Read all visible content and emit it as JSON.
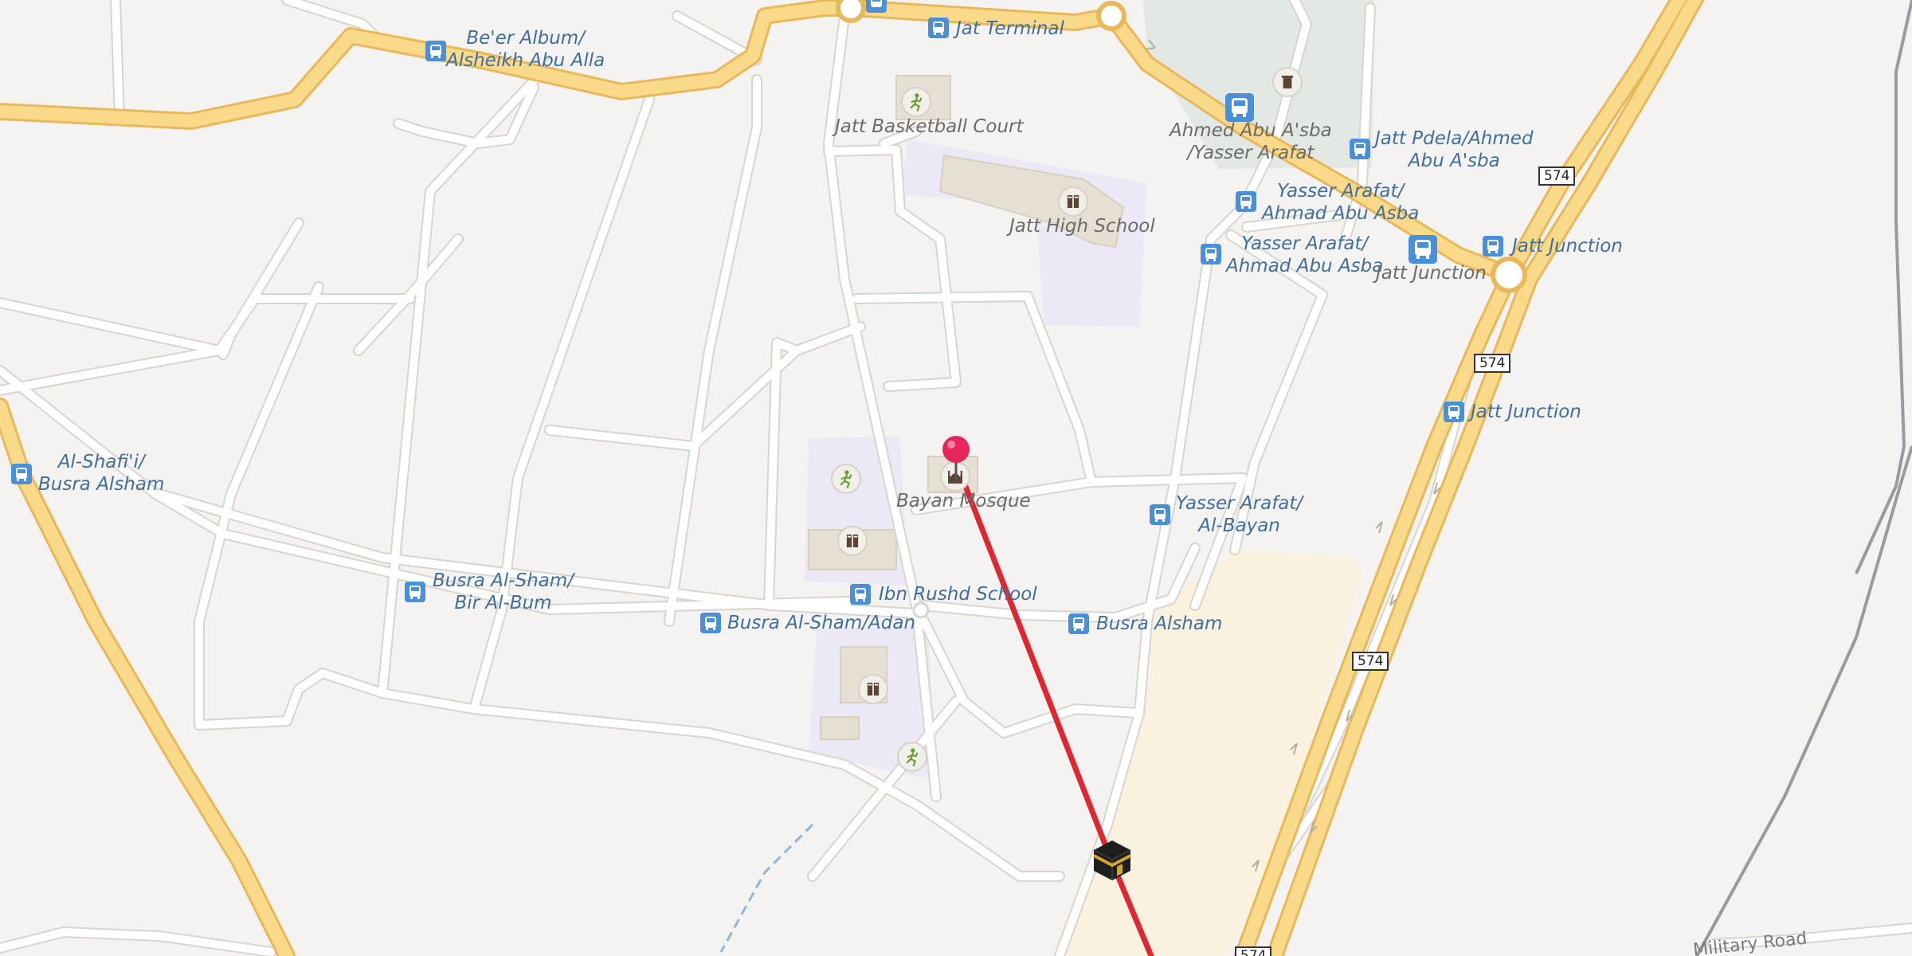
{
  "map": {
    "colors": {
      "background": "#f5f3f1",
      "minor_road": "#ffffff",
      "major_road": "#f9d98a",
      "major_road_casing": "#e8b85a",
      "school_area": "#ece8f6",
      "park_area": "#e3e8e4",
      "sand_area": "#faf1df",
      "route_line": "#e0262f",
      "bus_icon": "#4a90d9",
      "pin": "#e8265e",
      "bus_label": "#3f6f9a",
      "poi_label": "#6b6b6b"
    },
    "highway_ref": "574",
    "road_names": {
      "military_road": "Military Road"
    },
    "bus_stops": [
      {
        "id": "beer-album",
        "name": "Be'er Album/\nAlsheikh Abu Alla"
      },
      {
        "id": "jat-terminal",
        "name": "Jat Terminal"
      },
      {
        "id": "ahmed-abu-asba",
        "name": "Ahmed Abu A'sba\n/Yasser Arafat"
      },
      {
        "id": "jatt-pdela",
        "name": "Jatt Pdela/Ahmed\nAbu A'sba"
      },
      {
        "id": "yasser-arafat-1",
        "name": "Yasser Arafat/\nAhmad Abu Asba"
      },
      {
        "id": "yasser-arafat-2",
        "name": "Yasser Arafat/\nAhmad Abu Asba"
      },
      {
        "id": "jatt-junction-1",
        "name": "Jatt Junction"
      },
      {
        "id": "jatt-junction-2",
        "name": "Jatt Junction"
      },
      {
        "id": "jatt-junction-3",
        "name": "Jatt Junction"
      },
      {
        "id": "al-shafii",
        "name": "Al-Shafi'i/\nBusra Alsham"
      },
      {
        "id": "yasser-arafat-bayan",
        "name": "Yasser Arafat/\nAl-Bayan"
      },
      {
        "id": "busra-bir-al-bum",
        "name": "Busra Al-Sham/\nBir Al-Bum"
      },
      {
        "id": "ibn-rushd",
        "name": "Ibn Rushd School"
      },
      {
        "id": "busra-adan",
        "name": "Busra Al-Sham/Adan"
      },
      {
        "id": "busra-alsham",
        "name": "Busra Alsham"
      }
    ],
    "pois": [
      {
        "id": "basketball",
        "name": "Jatt Basketball Court",
        "icon": "sports-icon"
      },
      {
        "id": "high-school",
        "name": "Jatt High School",
        "icon": "school-icon"
      },
      {
        "id": "bayan-mosque",
        "name": "Bayan Mosque",
        "icon": "mosque-icon"
      }
    ],
    "destination_marker": "pin",
    "direction_marker": "kaaba-icon"
  }
}
